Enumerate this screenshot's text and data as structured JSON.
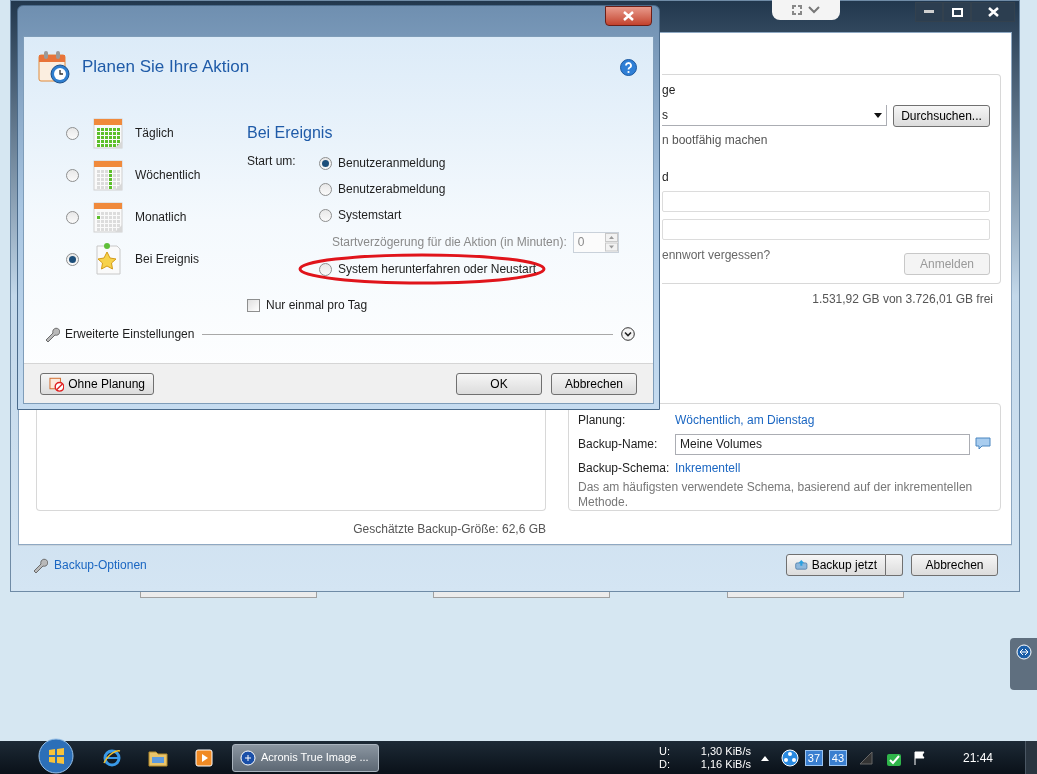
{
  "background_window": {
    "destination": {
      "label_fragment": "ge",
      "location_fragment": "s",
      "browse_button": "Durchsuchen...",
      "bootable_fragment": "n bootfähig machen",
      "password_label_fragment": "d",
      "forgot_password_fragment": "ennwort vergessen?",
      "login_button": {
        "label": "Anmelden",
        "disabled": true
      }
    },
    "free_space": "1.531,92 GB von 3.726,01 GB frei",
    "estimated_size": "Geschätzte Backup-Größe: 62,6 GB",
    "settings": [
      {
        "label": "Planung:",
        "value": "Wöchentlich, am Dienstag",
        "kind": "link"
      },
      {
        "label": "Backup-Name:",
        "value": "Meine Volumes",
        "kind": "field"
      },
      {
        "label": "Backup-Schema:",
        "value": "Inkrementell",
        "kind": "link"
      }
    ],
    "scheme_description": "Das am häufigsten verwendete Schema, basierend auf der inkrementellen Methode.",
    "options_link": "Backup-Optionen",
    "buttons": {
      "backup_now": "Backup jetzt",
      "cancel": "Abbrechen"
    }
  },
  "dialog": {
    "title": "Planen Sie Ihre Aktion",
    "frequencies": [
      {
        "label": "Täglich",
        "selected": false,
        "kind": "daily"
      },
      {
        "label": "Wöchentlich",
        "selected": false,
        "kind": "weekly"
      },
      {
        "label": "Monatlich",
        "selected": false,
        "kind": "monthly"
      },
      {
        "label": "Bei Ereignis",
        "selected": true,
        "kind": "event"
      }
    ],
    "section_title": "Bei Ereignis",
    "start_label": "Start um:",
    "events": [
      {
        "kind": "radio",
        "label": "Benutzeranmeldung",
        "selected": true,
        "highlighted": false
      },
      {
        "kind": "radio",
        "label": "Benutzerabmeldung",
        "selected": false,
        "highlighted": false
      },
      {
        "kind": "radio",
        "label": "Systemstart",
        "selected": false,
        "highlighted": false
      },
      {
        "kind": "delay",
        "label": "Startverzögerung für die Aktion (in Minuten):",
        "value": "0",
        "disabled": true
      },
      {
        "kind": "radio",
        "label": "System herunterfahren oder Neustart",
        "selected": false,
        "highlighted": true
      }
    ],
    "once_per_day": {
      "label": "Nur einmal pro Tag",
      "checked": false
    },
    "advanced": {
      "label": "Erweiterte Einstellungen",
      "expanded": false
    },
    "buttons": {
      "no_schedule": "Ohne Planung",
      "ok": "OK",
      "cancel": "Abbrechen"
    }
  },
  "taskbar": {
    "task": "Acronis True Image ...",
    "upload_label": "U:",
    "upload_rate": "1,30 KiB/s",
    "download_label": "D:",
    "download_rate": "1,16 KiB/s",
    "tray_badges": [
      "37",
      "43"
    ],
    "clock": "21:44"
  }
}
